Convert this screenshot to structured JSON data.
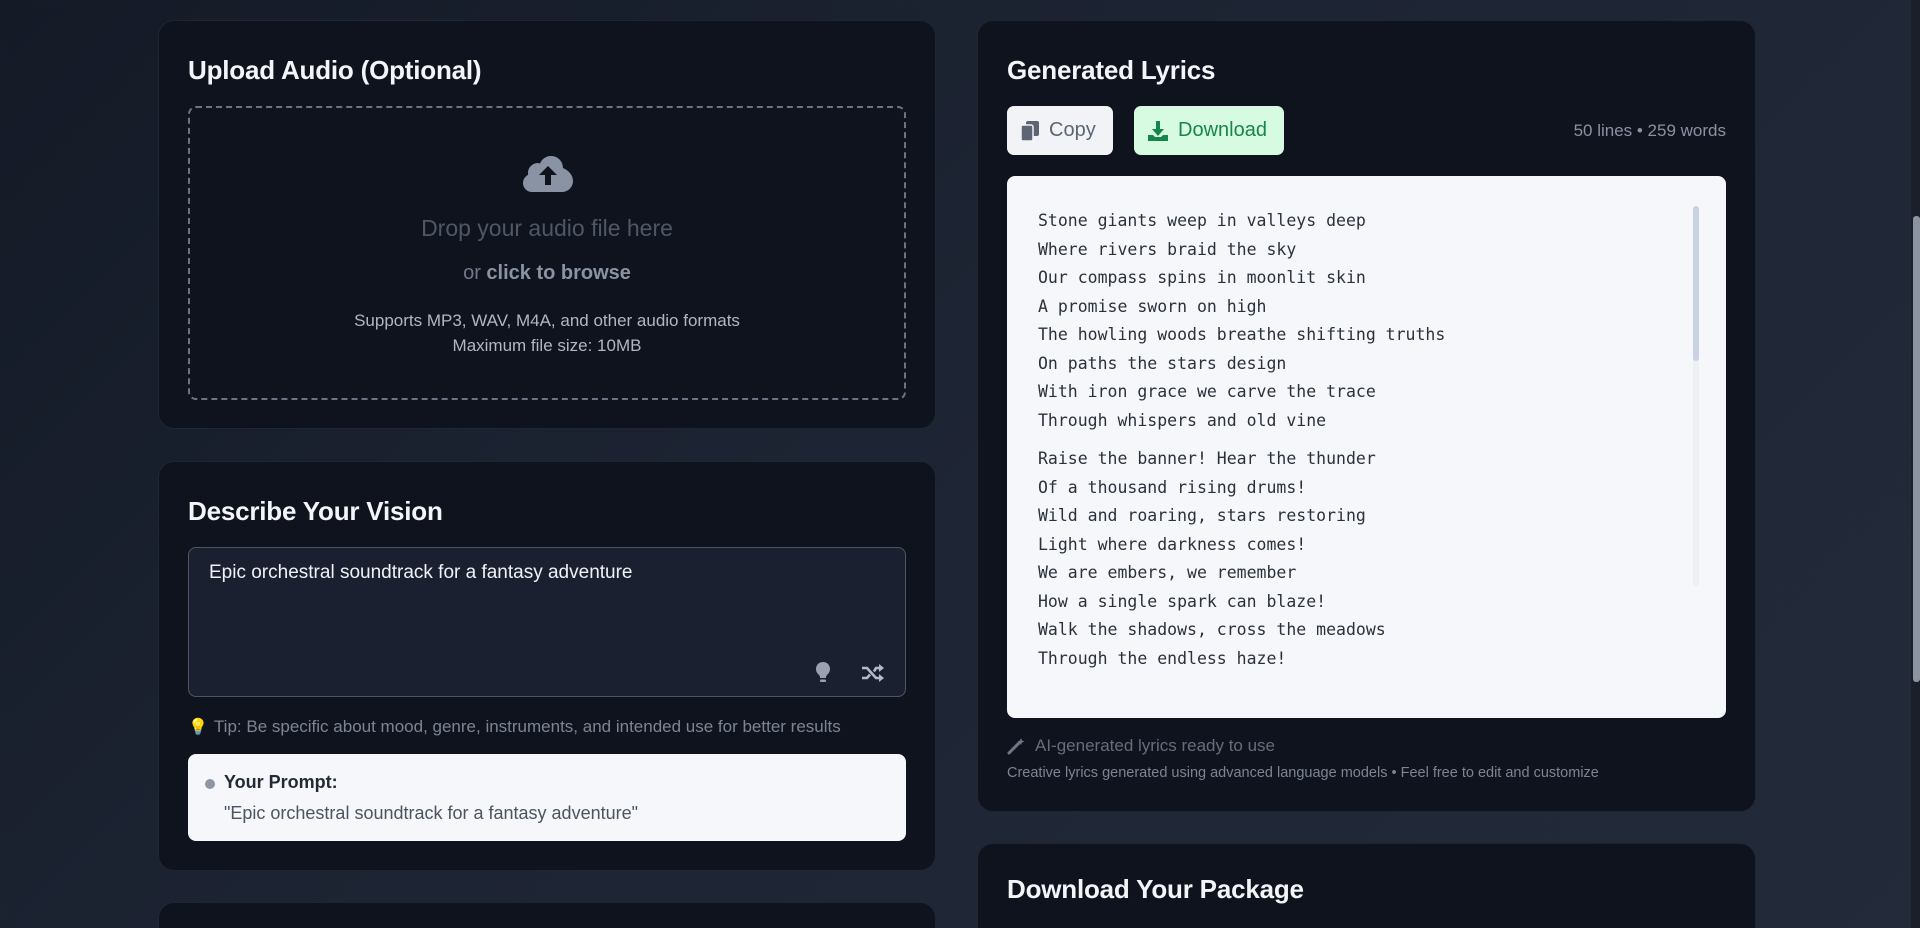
{
  "upload": {
    "title": "Upload Audio (Optional)",
    "drop_text": "Drop your audio file here",
    "or_text": "or ",
    "browse_text": "click to browse",
    "supports_text": "Supports MP3, WAV, M4A, and other audio formats",
    "max_size_text": "Maximum file size: 10MB",
    "icon": "cloud-upload-icon"
  },
  "vision": {
    "title": "Describe Your Vision",
    "prompt_value": "Epic orchestral soundtrack for a fantasy adventure",
    "tip": "Tip: Be specific about mood, genre, instruments, and intended use for better results",
    "your_prompt_label": "Your Prompt:",
    "your_prompt_value": "\"Epic orchestral soundtrack for a fantasy adventure\""
  },
  "lyrics": {
    "title": "Generated Lyrics",
    "copy_label": "Copy",
    "download_label": "Download",
    "stats": "50 lines • 259 words",
    "stanzas": [
      [
        "Stone giants weep in valleys deep",
        "Where rivers braid the sky",
        "Our compass spins in moonlit skin",
        "A promise sworn on high",
        "The howling woods breathe shifting truths",
        "On paths the stars design",
        "With iron grace we carve the trace",
        "Through whispers and old vine"
      ],
      [
        "Raise the banner! Hear the thunder",
        "Of a thousand rising drums!",
        "Wild and roaring, stars restoring",
        "Light where darkness comes!",
        "We are embers, we remember",
        "How a single spark can blaze!",
        "Walk the shadows, cross the meadows",
        "Through the endless haze!"
      ]
    ],
    "ai_note": "AI-generated lyrics ready to use",
    "ai_subnote": "Creative lyrics generated using advanced language models • Feel free to edit and customize"
  },
  "package": {
    "title": "Download Your Package"
  },
  "colors": {
    "card_bg": "#0f131d",
    "download_bg": "#d6fbe0",
    "download_text": "#18854a",
    "tip_bulb": "#f6c43a"
  }
}
